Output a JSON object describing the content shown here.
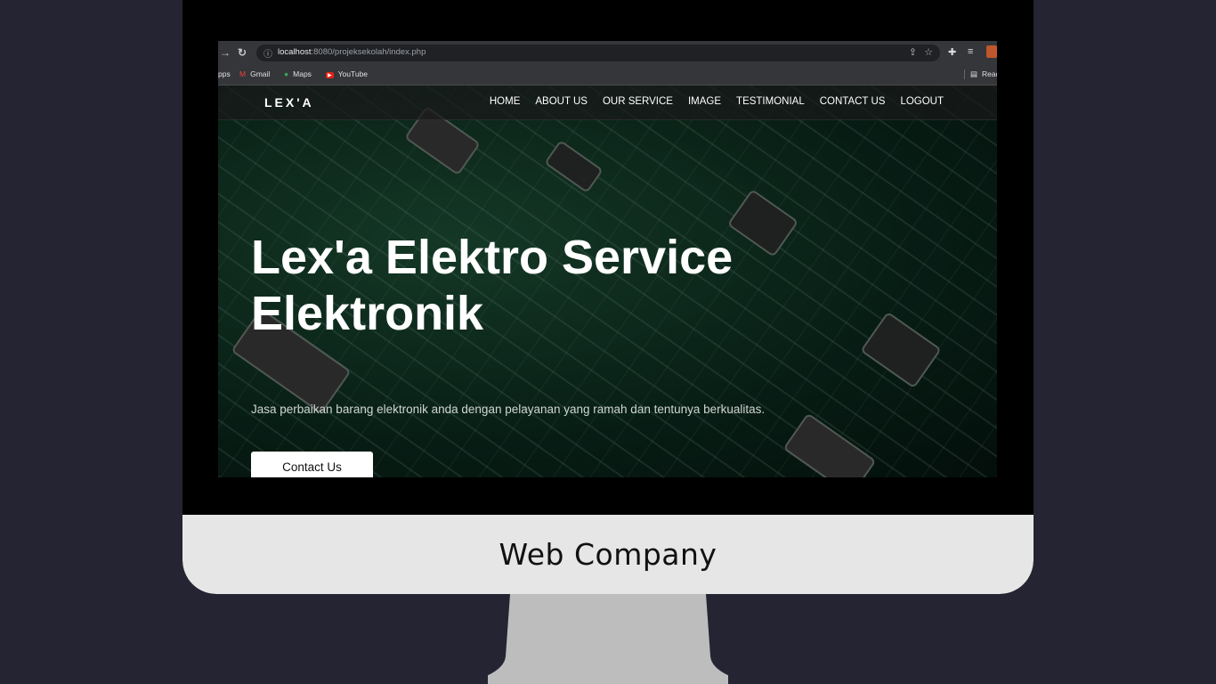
{
  "monitor_caption": "Web Company",
  "browser": {
    "url_host": "localhost",
    "url_rest": ":8080/projeksekolah/index.php",
    "bookmarks": [
      {
        "label": "pps",
        "icon": "apps-icon"
      },
      {
        "label": "Gmail",
        "icon": "gmail-icon"
      },
      {
        "label": "Maps",
        "icon": "maps-icon"
      },
      {
        "label": "YouTube",
        "icon": "youtube-icon"
      }
    ],
    "reading_list_label": "Readi"
  },
  "site": {
    "brand": "LEX'A",
    "menu": [
      "HOME",
      "ABOUT US",
      "OUR SERVICE",
      "IMAGE",
      "TESTIMONIAL",
      "CONTACT US",
      "LOGOUT"
    ],
    "hero_title_line1": "Lex'a Elektro Service",
    "hero_title_line2": "Elektronik",
    "hero_subtitle": "Jasa perbaikan barang elektronik anda dengan pelayanan yang ramah dan tentunya berkualitas.",
    "hero_button": "Contact Us"
  },
  "colors": {
    "background": "#252433",
    "chin": "#e6e6e6",
    "stand": "#bdbdbd",
    "pcb_green": "#143a29"
  }
}
